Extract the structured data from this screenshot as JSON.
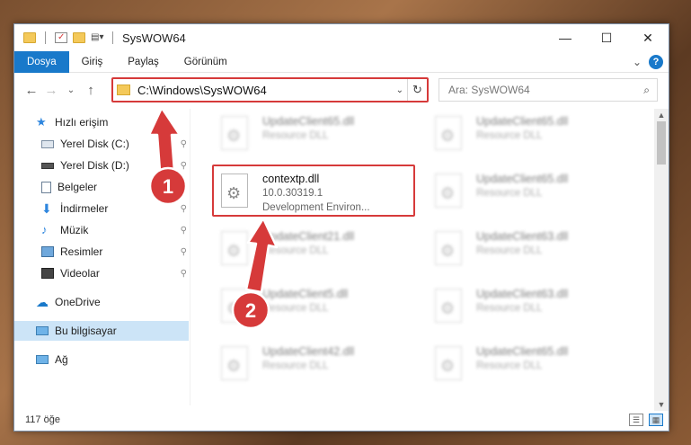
{
  "window": {
    "title": "SysWOW64",
    "controls": {
      "minimize": "—",
      "maximize": "☐",
      "close": "✕"
    }
  },
  "ribbon": {
    "tabs": [
      "Dosya",
      "Giriş",
      "Paylaş",
      "Görünüm"
    ],
    "active_tab": "Dosya",
    "collapse_glyph": "⌄",
    "help_glyph": "?"
  },
  "nav": {
    "back": "←",
    "forward": "→",
    "recent": "⌄",
    "up": "↑",
    "address": "C:\\Windows\\SysWOW64",
    "address_dropdown": "⌄",
    "refresh": "↻",
    "search_placeholder": "Ara: SysWOW64",
    "search_icon": "⌕"
  },
  "sidebar": {
    "items": [
      {
        "label": "Hızlı erişim",
        "icon": "star-icon",
        "pinned": false
      },
      {
        "label": "Yerel Disk (C:)",
        "icon": "drive-icon",
        "pinned": true
      },
      {
        "label": "Yerel Disk (D:)",
        "icon": "drive-icon",
        "pinned": true
      },
      {
        "label": "Belgeler",
        "icon": "document-icon",
        "pinned": true
      },
      {
        "label": "İndirmeler",
        "icon": "download-icon",
        "pinned": true
      },
      {
        "label": "Müzik",
        "icon": "music-icon",
        "pinned": true
      },
      {
        "label": "Resimler",
        "icon": "pictures-icon",
        "pinned": true
      },
      {
        "label": "Videolar",
        "icon": "video-icon",
        "pinned": true
      },
      {
        "label": "OneDrive",
        "icon": "cloud-icon",
        "pinned": false
      },
      {
        "label": "Bu bilgisayar",
        "icon": "computer-icon",
        "pinned": false,
        "selected": true
      },
      {
        "label": "Ağ",
        "icon": "network-icon",
        "pinned": false
      }
    ],
    "pin_glyph": "📌"
  },
  "files": {
    "left_column": [
      {
        "name": "UpdateClient65.dll",
        "type": "Resource DLL",
        "blurred": true
      },
      {
        "name": "contextp.dll",
        "version": "10.0.30319.1",
        "desc": "Development Environ...",
        "blurred": false
      },
      {
        "name": "UpdateClient21.dll",
        "type": "Resource DLL",
        "blurred": true
      },
      {
        "name": "UpdateClient5.dll",
        "type": "Resource DLL",
        "blurred": true
      },
      {
        "name": "UpdateClient42.dll",
        "type": "Resource DLL",
        "blurred": true
      }
    ],
    "right_column": [
      {
        "name": "UpdateClient65.dll",
        "type": "Resource DLL"
      },
      {
        "name": "UpdateClient65.dll",
        "type": "Resource DLL"
      },
      {
        "name": "UpdateClient63.dll",
        "type": "Resource DLL"
      },
      {
        "name": "UpdateClient63.dll",
        "type": "Resource DLL"
      },
      {
        "name": "UpdateClient65.dll",
        "type": "Resource DLL"
      }
    ]
  },
  "status": {
    "item_count": "117 öğe"
  },
  "annotations": {
    "step1": "1",
    "step2": "2",
    "color": "#d63a3a"
  }
}
